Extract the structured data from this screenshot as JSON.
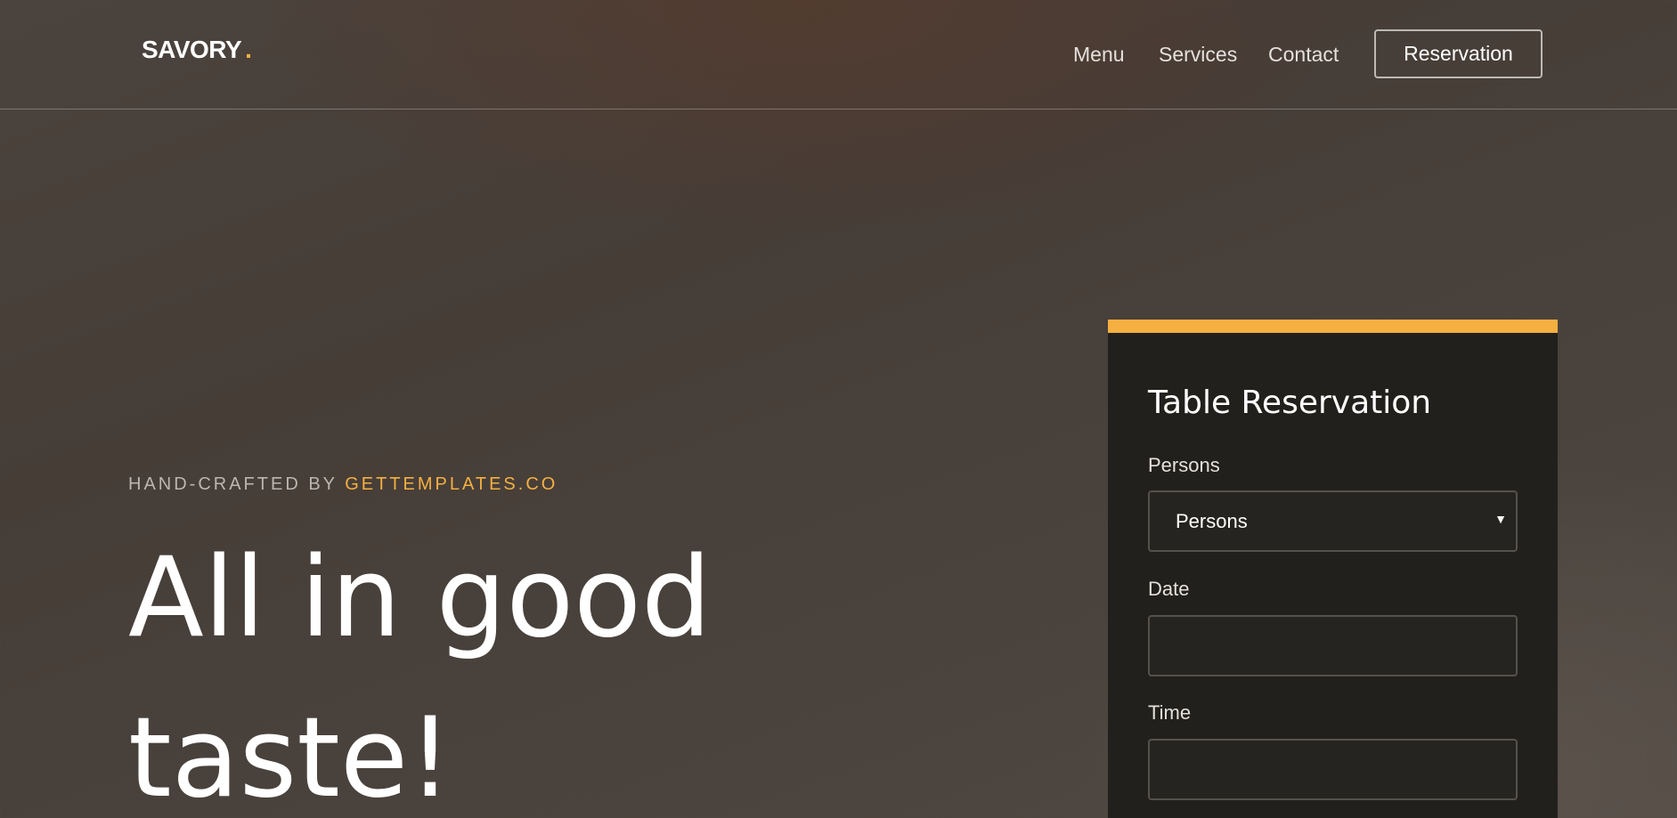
{
  "colors": {
    "accent": "#f5b041",
    "card_background": "#22201d"
  },
  "header": {
    "logo_text": "SAVORY",
    "logo_dot": ".",
    "nav": {
      "menu": "Menu",
      "services": "Services",
      "contact": "Contact",
      "reservation": "Reservation"
    }
  },
  "hero": {
    "eyebrow_prefix": "HAND-CRAFTED BY",
    "eyebrow_brand": "GETTEMPLATES.CO",
    "title": "All in good taste!"
  },
  "reservation": {
    "title": "Table Reservation",
    "persons_label": "Persons",
    "persons_value": "Persons",
    "persons_icon": "chevron-down-icon",
    "date_label": "Date",
    "date_value": "",
    "time_label": "Time",
    "time_value": ""
  }
}
